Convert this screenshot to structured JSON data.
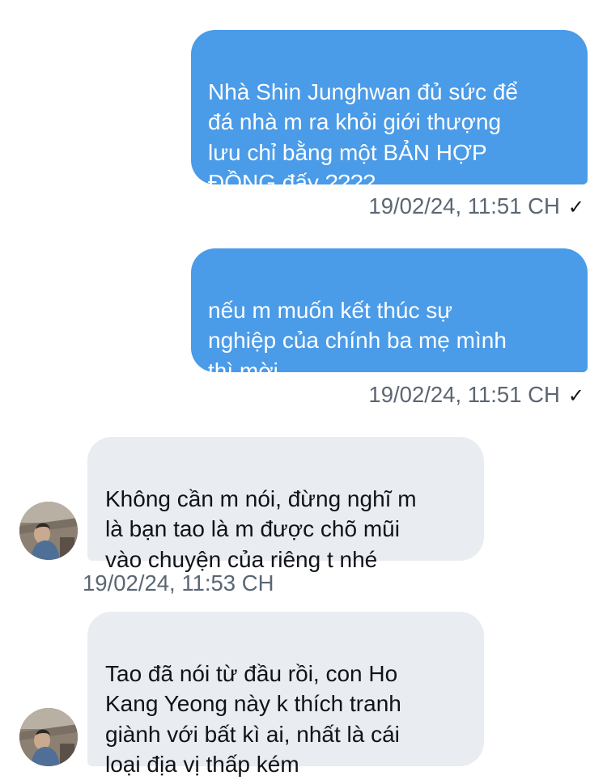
{
  "messages": [
    {
      "direction": "sent",
      "text": "Nhà Shin Junghwan đủ sức để\nđá nhà m ra khỏi giới thượng\nlưu chỉ bằng một BẢN HỢP\nĐỒNG đấy ????",
      "timestamp": "19/02/24, 11:51 CH",
      "status_icon": "check-icon",
      "status_glyph": "✓"
    },
    {
      "direction": "sent",
      "text": "nếu m muốn kết thúc sự\nnghiệp của chính ba mẹ mình\nthì mời",
      "timestamp": "19/02/24, 11:51 CH",
      "status_icon": "check-icon",
      "status_glyph": "✓"
    },
    {
      "direction": "received",
      "text": "Không cần m nói, đừng nghĩ m\nlà bạn tao là m được chõ mũi\nvào chuyện của riêng t nhé",
      "timestamp": "19/02/24, 11:53 CH",
      "avatar_icon": "avatar"
    },
    {
      "direction": "received",
      "text": "Tao đã nói từ đầu rồi, con Ho\nKang Yeong này k thích tranh\ngiành với bất kì ai, nhất là cái\nloại địa vị thấp kém",
      "avatar_icon": "avatar"
    }
  ],
  "colors": {
    "sent_bubble": "#4a9be8",
    "received_bubble": "#e9ecf0",
    "timestamp": "#5b6673",
    "background": "#ffffff"
  }
}
